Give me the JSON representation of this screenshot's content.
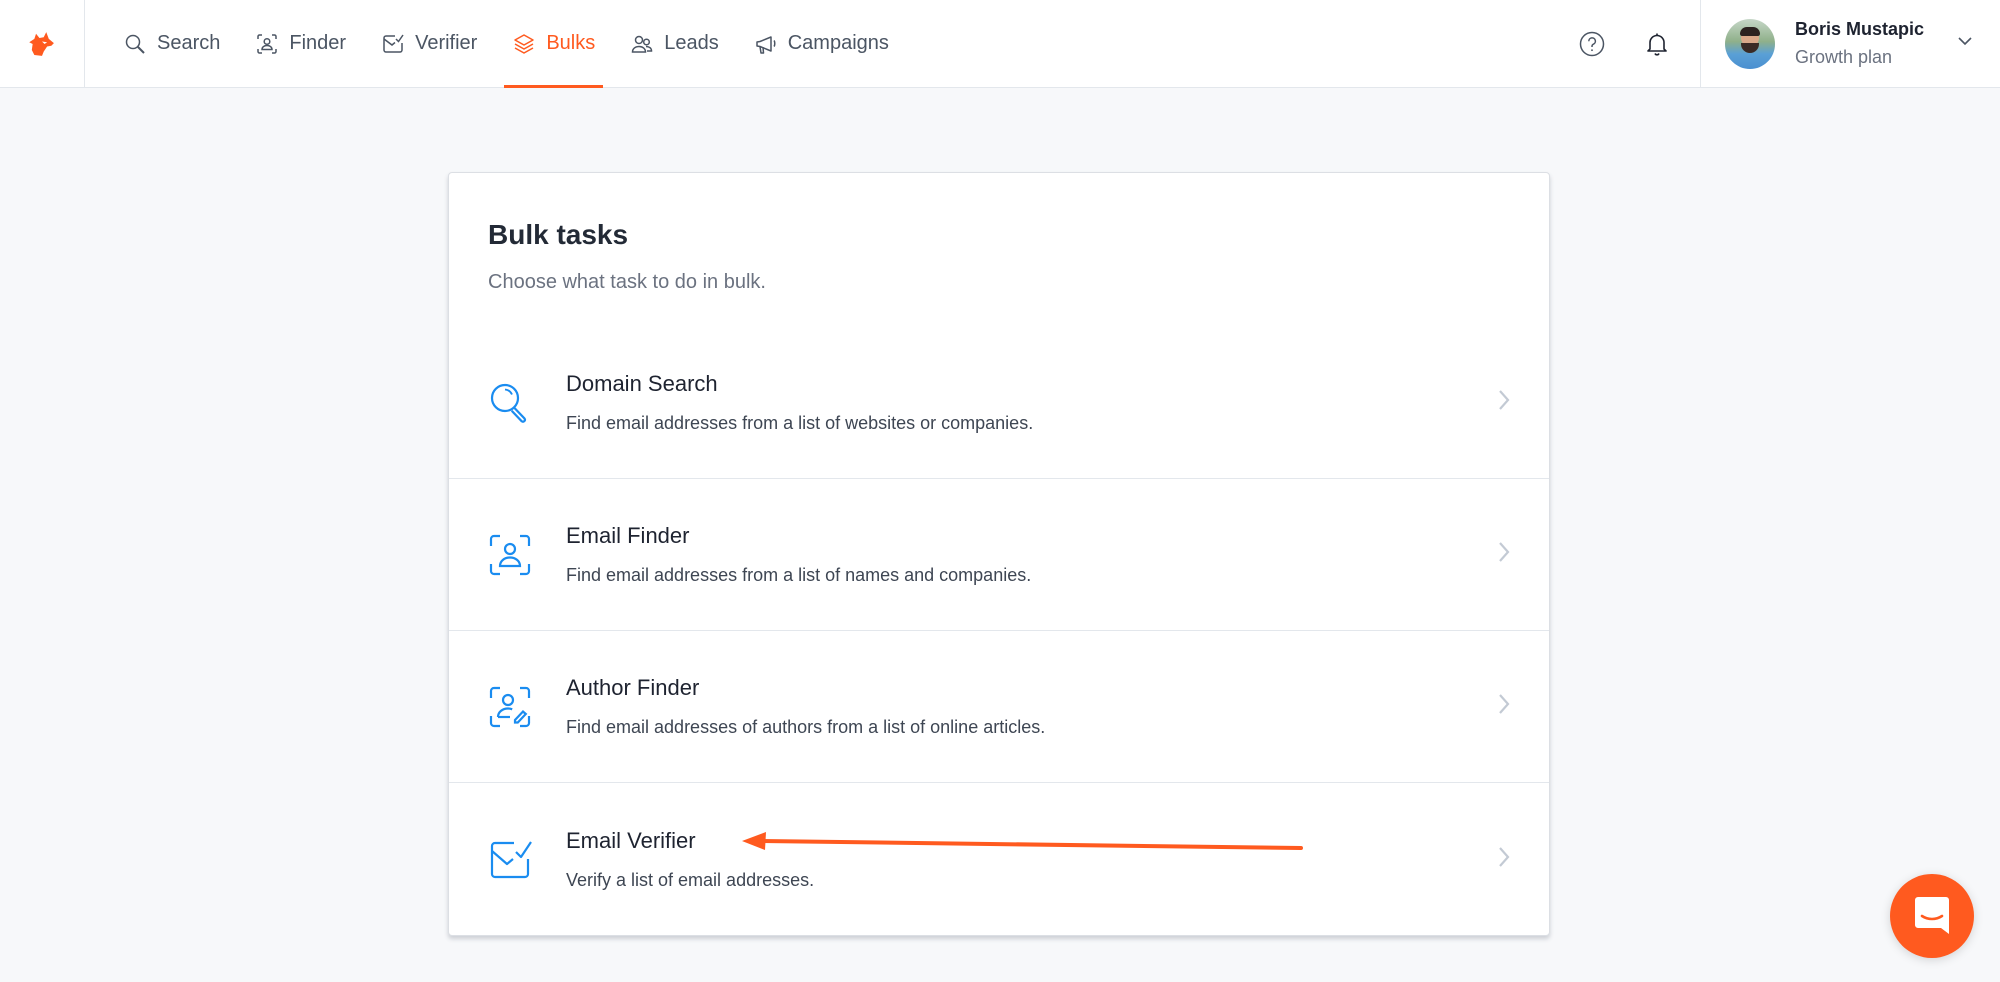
{
  "brand": {
    "accent": "#ff5a1f",
    "icon_blue": "#1a8cf0",
    "logo": "fox-logo-icon"
  },
  "nav": {
    "items": [
      {
        "label": "Search",
        "icon": "search-icon",
        "active": false
      },
      {
        "label": "Finder",
        "icon": "person-scan-icon",
        "active": false
      },
      {
        "label": "Verifier",
        "icon": "mail-check-icon",
        "active": false
      },
      {
        "label": "Bulks",
        "icon": "layers-icon",
        "active": true
      },
      {
        "label": "Leads",
        "icon": "users-icon",
        "active": false
      },
      {
        "label": "Campaigns",
        "icon": "megaphone-icon",
        "active": false
      }
    ]
  },
  "tools": {
    "help_icon": "help-icon",
    "notifications_icon": "bell-icon"
  },
  "account": {
    "name": "Boris Mustapic",
    "plan": "Growth plan"
  },
  "card": {
    "title": "Bulk tasks",
    "subtitle": "Choose what task to do in bulk.",
    "tasks": [
      {
        "title": "Domain Search",
        "description": "Find email addresses from a list of websites or companies.",
        "icon": "search-icon"
      },
      {
        "title": "Email Finder",
        "description": "Find email addresses from a list of names and companies.",
        "icon": "person-scan-icon"
      },
      {
        "title": "Author Finder",
        "description": "Find email addresses of authors from a list of online articles.",
        "icon": "author-scan-icon"
      },
      {
        "title": "Email Verifier",
        "description": "Verify a list of email addresses.",
        "icon": "mail-check-icon"
      }
    ]
  },
  "annotation": {
    "type": "arrow",
    "color": "#ff5a1f",
    "points_to": "Email Verifier"
  },
  "chat": {
    "icon": "chat-icon"
  }
}
